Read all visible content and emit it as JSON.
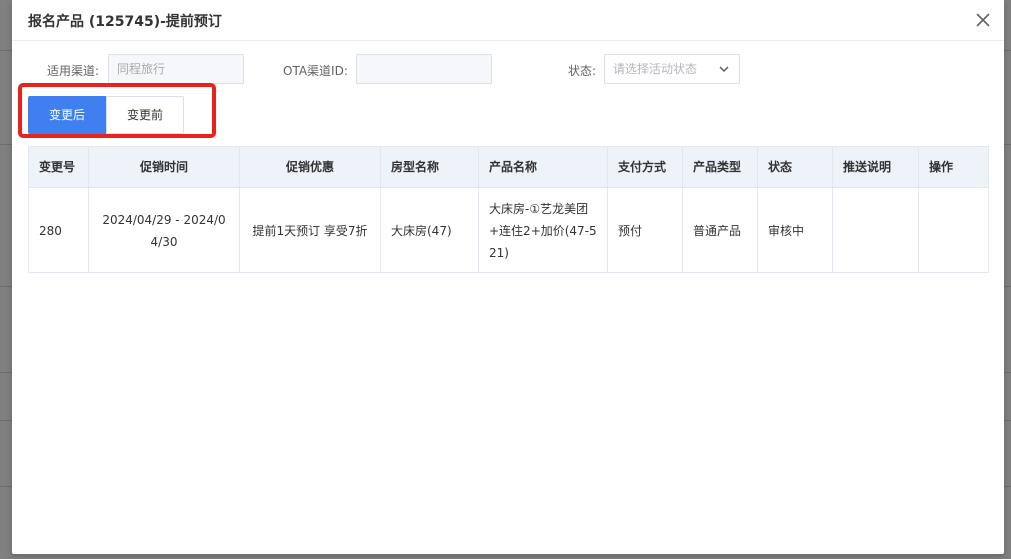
{
  "dialog": {
    "title": "报名产品 (125745)-提前预订"
  },
  "filters": {
    "channel_label": "适用渠道:",
    "channel_value": "同程旅行",
    "ota_label": "OTA渠道ID:",
    "ota_value": "",
    "status_label": "状态:",
    "status_placeholder": "请选择活动状态"
  },
  "toggle": {
    "after_label": "变更后",
    "before_label": "变更前"
  },
  "table": {
    "headers": [
      "变更号",
      "促销时间",
      "促销优惠",
      "房型名称",
      "产品名称",
      "支付方式",
      "产品类型",
      "状态",
      "推送说明",
      "操作"
    ],
    "rows": [
      {
        "change_no": "280",
        "promo_time": "2024/04/29 - 2024/04/30",
        "promo_offer": "提前1天预订 享受7折",
        "room_type": "大床房(47)",
        "product_name": "大床房-①艺龙美团+连住2+加价(47-521)",
        "payment": "预付",
        "product_type": "普通产品",
        "status": "审核中",
        "push_note": "",
        "action": ""
      }
    ]
  },
  "colors": {
    "primary": "#3f7ff0",
    "highlight": "#e8231b",
    "header_bg": "#eef2f9"
  }
}
